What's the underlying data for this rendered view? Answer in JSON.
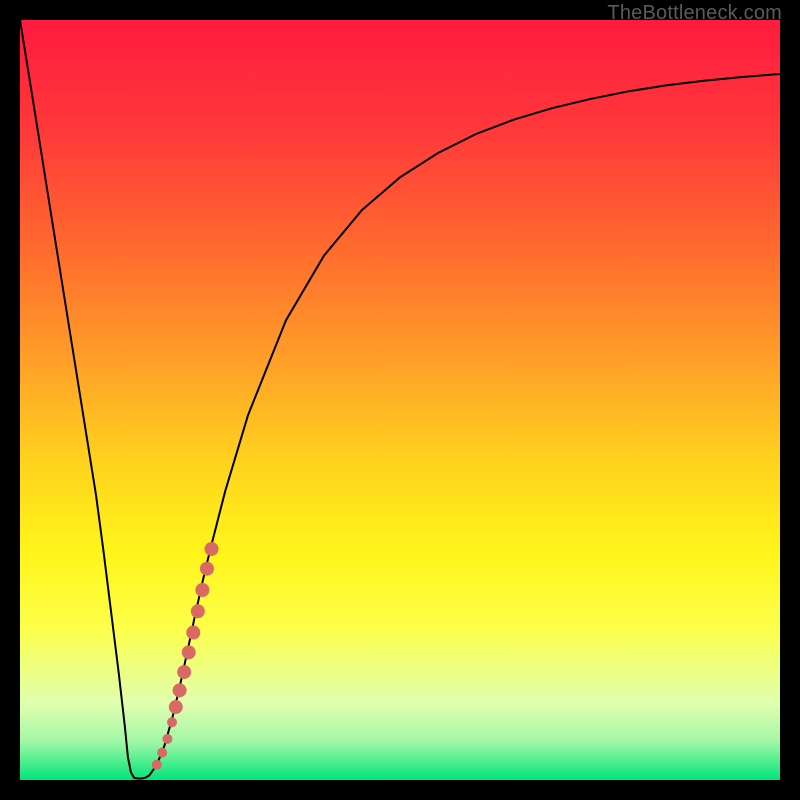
{
  "watermark": "TheBottleneck.com",
  "chart_data": {
    "type": "line",
    "title": "",
    "xlabel": "",
    "ylabel": "",
    "xlim": [
      0,
      100
    ],
    "ylim": [
      0,
      100
    ],
    "gradient_stops": [
      {
        "offset": 0.0,
        "color": "#ff1a3f"
      },
      {
        "offset": 0.15,
        "color": "#ff3a3a"
      },
      {
        "offset": 0.3,
        "color": "#ff6a2e"
      },
      {
        "offset": 0.45,
        "color": "#ffa028"
      },
      {
        "offset": 0.58,
        "color": "#ffd21e"
      },
      {
        "offset": 0.7,
        "color": "#fff51a"
      },
      {
        "offset": 0.8,
        "color": "#fdff4a"
      },
      {
        "offset": 0.9,
        "color": "#e0ffb0"
      },
      {
        "offset": 0.95,
        "color": "#a0f7a6"
      },
      {
        "offset": 1.0,
        "color": "#00e47a"
      }
    ],
    "series": [
      {
        "name": "bottleneck-curve",
        "color": "#000000",
        "width": 2,
        "points": [
          [
            0.0,
            100.0
          ],
          [
            2.0,
            87.6
          ],
          [
            4.0,
            75.0
          ],
          [
            6.0,
            62.5
          ],
          [
            8.0,
            50.0
          ],
          [
            10.0,
            37.5
          ],
          [
            11.0,
            30.0
          ],
          [
            12.0,
            22.0
          ],
          [
            13.0,
            14.0
          ],
          [
            13.8,
            7.0
          ],
          [
            14.2,
            3.0
          ],
          [
            14.6,
            1.0
          ],
          [
            15.0,
            0.3
          ],
          [
            15.5,
            0.2
          ],
          [
            16.0,
            0.2
          ],
          [
            16.5,
            0.3
          ],
          [
            17.0,
            0.6
          ],
          [
            18.0,
            2.0
          ],
          [
            19.0,
            4.5
          ],
          [
            20.0,
            8.0
          ],
          [
            21.0,
            12.2
          ],
          [
            22.0,
            16.8
          ],
          [
            23.0,
            21.5
          ],
          [
            24.0,
            26.0
          ],
          [
            25.0,
            30.2
          ],
          [
            27.0,
            38.0
          ],
          [
            30.0,
            48.0
          ],
          [
            35.0,
            60.5
          ],
          [
            40.0,
            69.0
          ],
          [
            45.0,
            75.0
          ],
          [
            50.0,
            79.3
          ],
          [
            55.0,
            82.5
          ],
          [
            60.0,
            85.0
          ],
          [
            65.0,
            86.9
          ],
          [
            70.0,
            88.4
          ],
          [
            75.0,
            89.6
          ],
          [
            80.0,
            90.6
          ],
          [
            85.0,
            91.4
          ],
          [
            90.0,
            92.0
          ],
          [
            95.0,
            92.5
          ],
          [
            100.0,
            92.9
          ]
        ]
      }
    ],
    "markers": {
      "name": "highlight-dots",
      "color": "#d86a63",
      "points": [
        {
          "x": 18.0,
          "y": 2.0,
          "r": 5
        },
        {
          "x": 18.7,
          "y": 3.6,
          "r": 5
        },
        {
          "x": 19.4,
          "y": 5.4,
          "r": 5
        },
        {
          "x": 20.0,
          "y": 7.6,
          "r": 5
        },
        {
          "x": 20.5,
          "y": 9.6,
          "r": 7
        },
        {
          "x": 21.0,
          "y": 11.8,
          "r": 7
        },
        {
          "x": 21.6,
          "y": 14.2,
          "r": 7
        },
        {
          "x": 22.2,
          "y": 16.8,
          "r": 7
        },
        {
          "x": 22.8,
          "y": 19.4,
          "r": 7
        },
        {
          "x": 23.4,
          "y": 22.2,
          "r": 7
        },
        {
          "x": 24.0,
          "y": 25.0,
          "r": 7
        },
        {
          "x": 24.6,
          "y": 27.8,
          "r": 7
        },
        {
          "x": 25.2,
          "y": 30.4,
          "r": 7
        }
      ]
    }
  }
}
